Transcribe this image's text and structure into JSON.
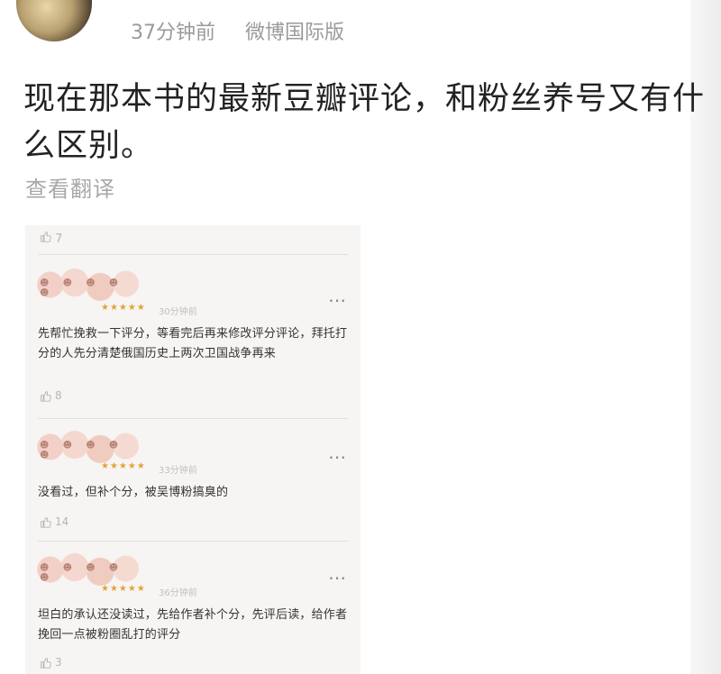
{
  "post": {
    "time": "37分钟前",
    "source": "微博国际版",
    "text": "现在那本书的最新豆瓣评论，和粉丝养号又有什么区别。",
    "translate": "查看翻译"
  },
  "screenshot": {
    "top_like_count": "7",
    "reviews": [
      {
        "time": "30分钟前",
        "stars": "★★★★★",
        "text": "先帮忙挽救一下评分，等看完后再来修改评分评论，拜托打分的人先分清楚俄国历史上两次卫国战争再来",
        "likes": "8"
      },
      {
        "time": "33分钟前",
        "stars": "★★★★★",
        "text": "没看过，但补个分，被吴博粉搞臭的",
        "likes": "14"
      },
      {
        "time": "36分钟前",
        "stars": "★★★★★",
        "text": "坦白的承认还没读过，先给作者补个分，先评后读，给作者挽回一点被粉圈乱打的评分",
        "likes": "3"
      }
    ]
  }
}
